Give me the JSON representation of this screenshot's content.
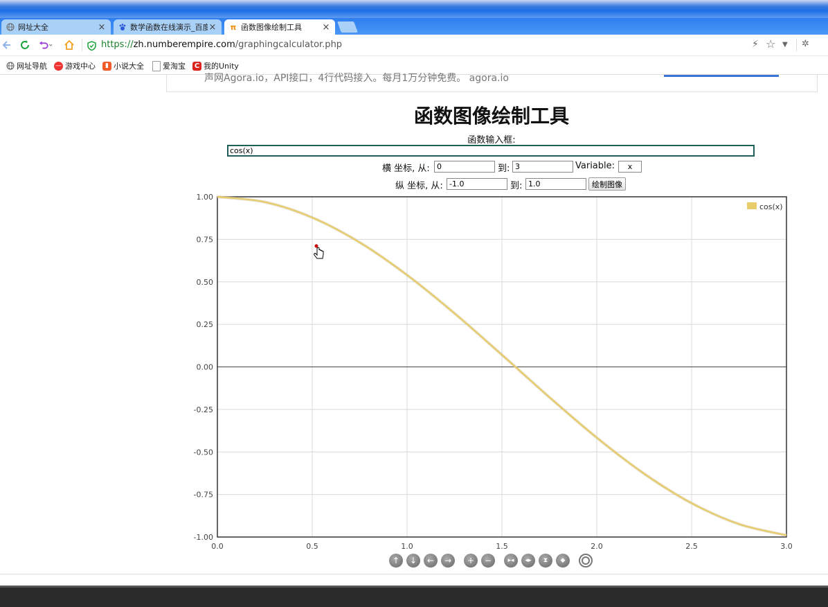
{
  "tabs": [
    {
      "label": "网址大全",
      "icon": "globe-icon"
    },
    {
      "label": "数学函数在线演示_百度",
      "icon": "baidu-paw-icon"
    },
    {
      "label": "函数图像绘制工具",
      "icon": "pi-icon",
      "icon_char": "π"
    }
  ],
  "tab_close": "×",
  "address": {
    "scheme": "https://",
    "host": "zh.numberempire.com",
    "path": "/graphingcalculator.php"
  },
  "bookmarks": [
    {
      "label": "网址导航"
    },
    {
      "label": "游戏中心"
    },
    {
      "label": "小说大全"
    },
    {
      "label": "爱淘宝"
    },
    {
      "label": "我的Unity"
    }
  ],
  "ad": {
    "text": "声网Agora.io，API接口，4行代码接入。每月1万分钟免费。 agora.io"
  },
  "page": {
    "title": "函数图像绘制工具",
    "function_label": "函数输入框:",
    "function_value": "cos(x)",
    "x_range": {
      "label": "横 坐标, 从:",
      "from": "0",
      "to_label": "到:",
      "to": "3",
      "var_label": "Variable:",
      "var": "x"
    },
    "y_range": {
      "label": "纵 坐标, 从:",
      "from": "-1.0",
      "to_label": "到:",
      "to": "1.0"
    },
    "draw_button": "绘制图像"
  },
  "chart_data": {
    "type": "line",
    "function": "cos(x)",
    "series": [
      {
        "name": "cos(x)",
        "color": "#e8cd6a",
        "x": [
          0,
          0.25,
          0.5,
          0.75,
          1.0,
          1.25,
          1.5,
          1.75,
          2.0,
          2.25,
          2.5,
          2.75,
          3.0
        ],
        "y": [
          1.0,
          0.969,
          0.878,
          0.732,
          0.54,
          0.315,
          0.071,
          -0.178,
          -0.416,
          -0.628,
          -0.801,
          -0.924,
          -0.99
        ]
      }
    ],
    "xlim": [
      0,
      3
    ],
    "ylim": [
      -1,
      1
    ],
    "xticks": [
      "0.0",
      "0.5",
      "1.0",
      "1.5",
      "2.0",
      "2.5",
      "3.0"
    ],
    "yticks": [
      "1.00",
      "0.75",
      "0.50",
      "0.25",
      "0.00",
      "-0.25",
      "-0.50",
      "-0.75",
      "-1.00"
    ],
    "grid": true,
    "legend": "top-right"
  },
  "toolbar": [
    "up-arrow-icon",
    "down-arrow-icon",
    "left-arrow-icon",
    "right-arrow-icon",
    "zoom-in-icon",
    "zoom-out-icon",
    "shrink-horizontal-icon",
    "expand-horizontal-icon",
    "shrink-vertical-icon",
    "expand-vertical-icon",
    "reset-icon"
  ]
}
